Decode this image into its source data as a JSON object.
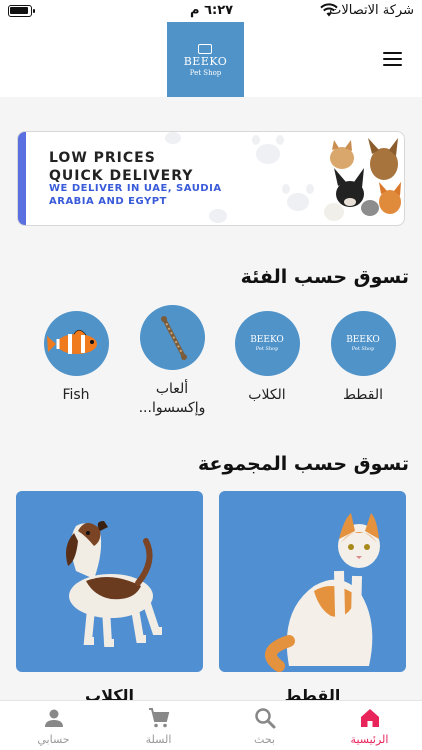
{
  "status_bar": {
    "carrier": "شركة الاتصالات",
    "time": "٦:٢٧ م"
  },
  "header": {
    "logo_name": "BEEKO",
    "logo_sub": "Pet Shop"
  },
  "banner": {
    "line1": "LOW PRICES",
    "line2": "QUICK DELIVERY",
    "line3": "WE DELIVER IN UAE, SAUDIA",
    "line4": "ARABIA AND EGYPT"
  },
  "categories": {
    "title": "تسوق حسب الفئة",
    "items": [
      {
        "label": "القطط",
        "icon": "beeko-logo"
      },
      {
        "label": "الكلاب",
        "icon": "beeko-logo"
      },
      {
        "label": "ألعاب وإكسسوا...",
        "icon": "rope-toy"
      },
      {
        "label": "Fish",
        "icon": "clownfish"
      }
    ]
  },
  "groups": {
    "title": "تسوق حسب المجموعة",
    "items": [
      {
        "label": "القطط",
        "image": "cat-photo"
      },
      {
        "label": "الكلاب",
        "image": "dog-photo"
      }
    ]
  },
  "tabbar": {
    "items": [
      {
        "label": "الرئيسية",
        "icon": "home-icon",
        "active": true
      },
      {
        "label": "بحث",
        "icon": "search-icon",
        "active": false
      },
      {
        "label": "السلة",
        "icon": "cart-icon",
        "active": false
      },
      {
        "label": "حسابي",
        "icon": "account-icon",
        "active": false
      }
    ]
  },
  "colors": {
    "brand": "#4f93c9",
    "accent_pink": "#e8255b",
    "banner_accent": "#5b70e0"
  }
}
